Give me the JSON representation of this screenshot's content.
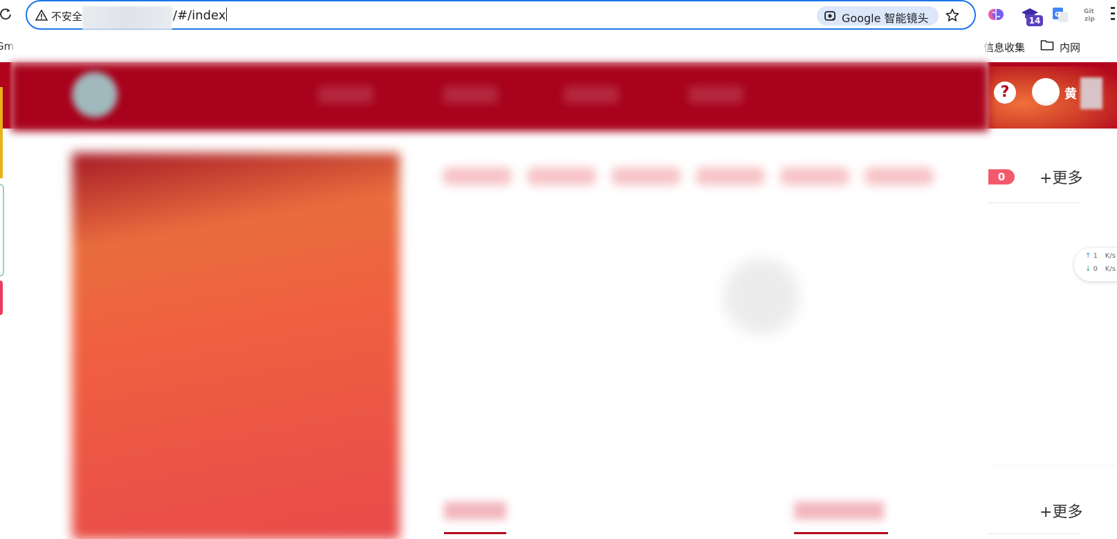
{
  "browser": {
    "insecure_label": "不安全",
    "url_path": "/#/index",
    "lens_label": "Google 智能镜头",
    "extension_badge": "14",
    "bookmarks": {
      "left_partial": "Gm",
      "info_collect": "信息收集",
      "intranet": "内网"
    },
    "icons": [
      "reload-icon",
      "warning-icon",
      "lens-icon",
      "star-icon",
      "brain-extension-icon",
      "graduation-cap-extension-icon",
      "translate-extension-icon",
      "gitzip-extension-icon",
      "folder-icon"
    ]
  },
  "header": {
    "help_symbol": "?",
    "user_name": "黄"
  },
  "panel": {
    "count_badge": "0",
    "more_top": "+更多",
    "more_bottom": "+更多"
  },
  "speed_widget": {
    "up_value": "1",
    "up_unit": "K/s",
    "down_value": "0",
    "down_unit": "K/s"
  },
  "colors": {
    "header_red": "#b3041d",
    "omnibox_blue": "#1a73e8",
    "badge_pink": "#f25a6c"
  }
}
